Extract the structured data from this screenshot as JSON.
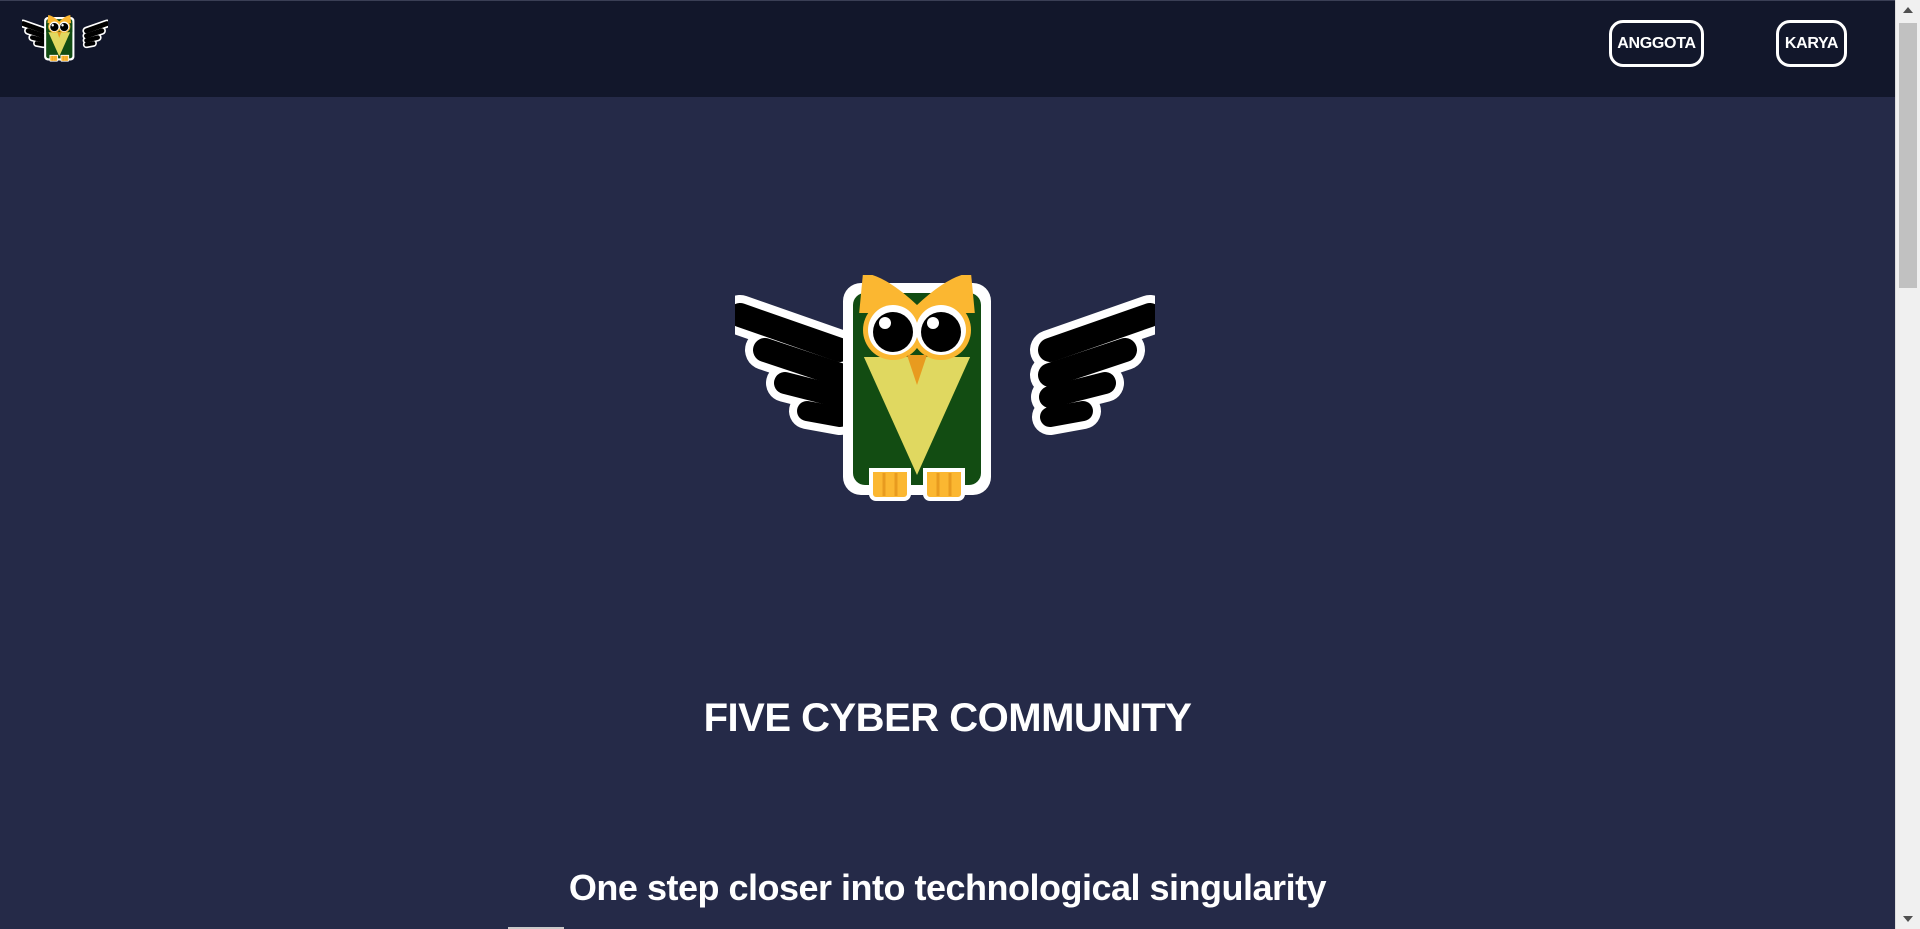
{
  "nav": {
    "logo_icon": "owl-logo-icon",
    "buttons": [
      {
        "label": "ANGGOTA"
      },
      {
        "label": "KARYA"
      }
    ]
  },
  "hero": {
    "image_icon": "owl-mascot-icon",
    "title": "FIVE CYBER COMMUNITY",
    "tagline": "One step closer into technological singularity"
  },
  "colors": {
    "background": "#252a48",
    "navbar": "#12172b",
    "text": "#ffffff",
    "owl_body": "#124c12",
    "owl_chest": "#e0d860",
    "owl_accent": "#fbb731",
    "owl_wing": "#000000"
  }
}
